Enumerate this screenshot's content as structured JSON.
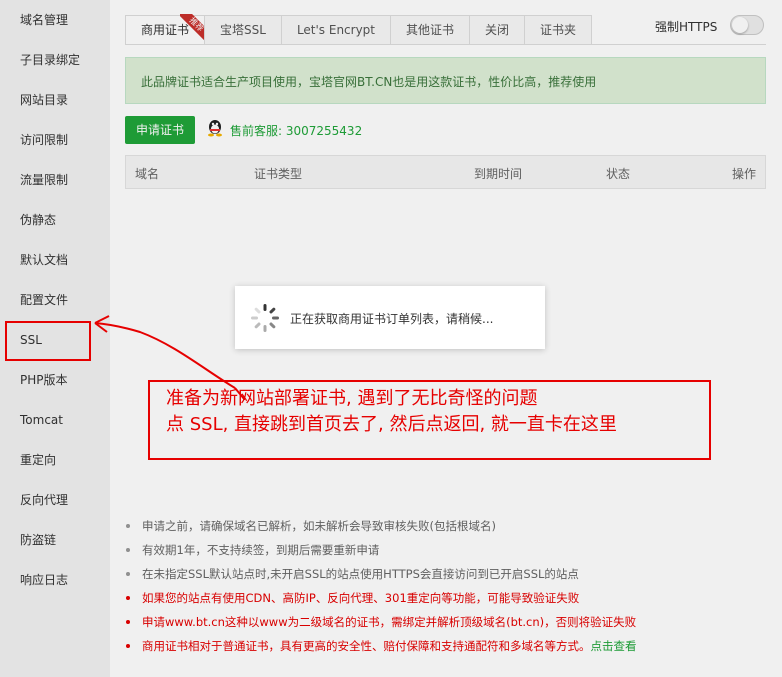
{
  "sidebar": {
    "items": [
      "域名管理",
      "子目录绑定",
      "网站目录",
      "访问限制",
      "流量限制",
      "伪静态",
      "默认文档",
      "配置文件",
      "SSL",
      "PHP版本",
      "Tomcat",
      "重定向",
      "反向代理",
      "防盗链",
      "响应日志"
    ]
  },
  "tabs": [
    {
      "label": "商用证书",
      "badge": "推荐"
    },
    {
      "label": "宝塔SSL"
    },
    {
      "label": "Let's Encrypt"
    },
    {
      "label": "其他证书"
    },
    {
      "label": "关闭"
    },
    {
      "label": "证书夹"
    }
  ],
  "https_label": "强制HTTPS",
  "alert_text": "此品牌证书适合生产项目使用，宝塔官网BT.CN也是用这款证书，性价比高，推荐使用",
  "apply_button": "申请证书",
  "service_text": "售前客服: 3007255432",
  "table": {
    "columns": [
      "域名",
      "证书类型",
      "到期时间",
      "状态",
      "操作"
    ]
  },
  "loading_text": "正在获取商用证书订单列表，请稍候...",
  "annotation": {
    "line1": "准备为新网站部署证书, 遇到了无比奇怪的问题",
    "line2": "点 SSL, 直接跳到首页去了, 然后点返回, 就一直卡在这里"
  },
  "tips": [
    {
      "text": "申请之前，请确保域名已解析，如未解析会导致审核失败(包括根域名)",
      "red": false
    },
    {
      "text": "有效期1年，不支持续签，到期后需要重新申请",
      "red": false
    },
    {
      "text": "在未指定SSL默认站点时,未开启SSL的站点使用HTTPS会直接访问到已开启SSL的站点",
      "red": false
    },
    {
      "text": "如果您的站点有使用CDN、高防IP、反向代理、301重定向等功能，可能导致验证失败",
      "red": true
    },
    {
      "text": "申请www.bt.cn这种以www为二级域名的证书，需绑定并解析顶级域名(bt.cn)，否则将验证失败",
      "red": true
    },
    {
      "text": "商用证书相对于普通证书，具有更高的安全性、赔付保障和支持通配符和多域名等方式。",
      "red": true,
      "link": "点击查看"
    }
  ],
  "colors": {
    "accent": "#20a53a",
    "annotation": "#e60000",
    "alert_bg": "#dff0d8"
  }
}
